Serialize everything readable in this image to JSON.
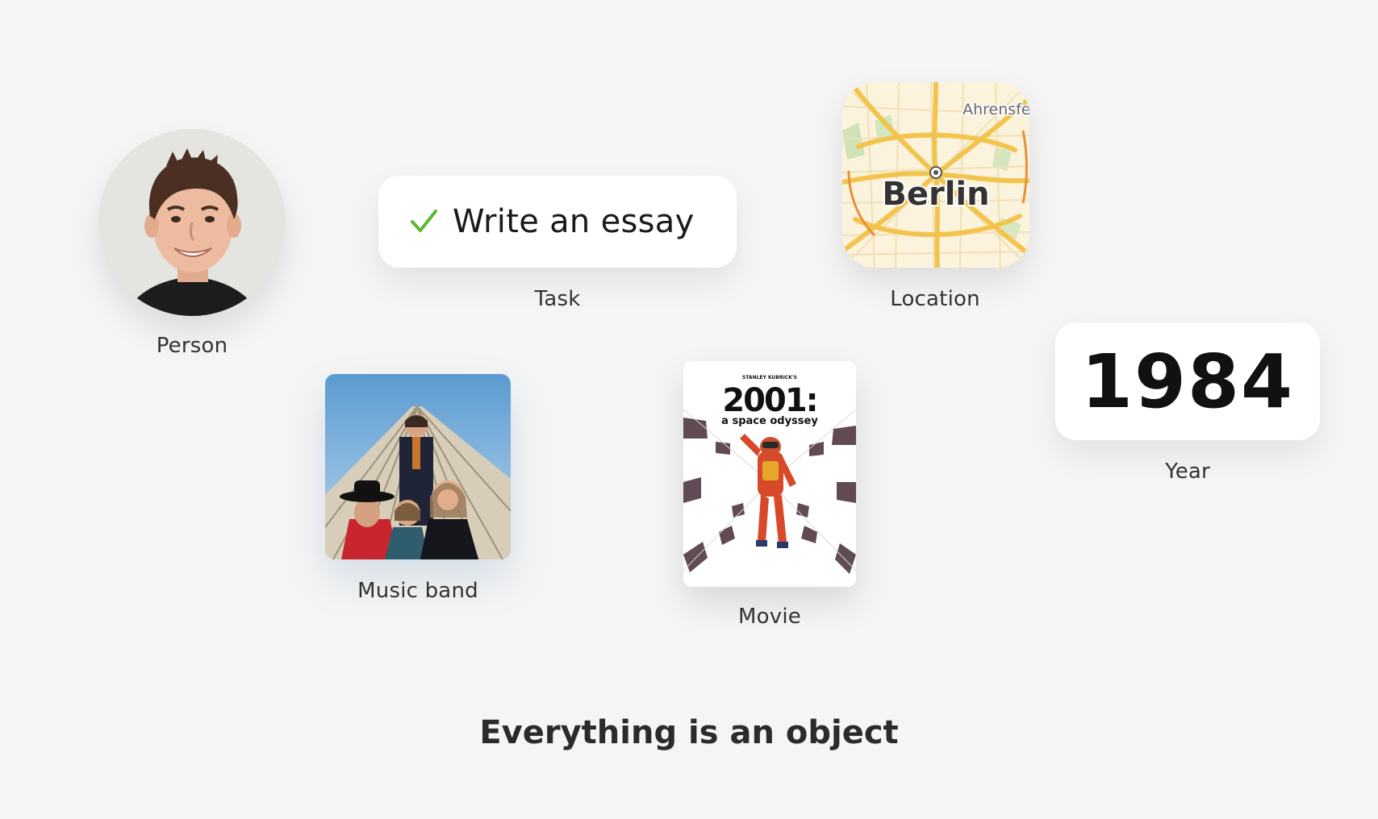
{
  "objects": {
    "person": {
      "label": "Person"
    },
    "task": {
      "label": "Task",
      "title": "Write an essay",
      "completed": true,
      "check_color": "#5cb82e"
    },
    "location": {
      "label": "Location",
      "city": "Berlin",
      "nearby": "Ahrensfel"
    },
    "year": {
      "label": "Year",
      "value": "1984"
    },
    "band": {
      "label": "Music band"
    },
    "movie": {
      "label": "Movie",
      "poster_credit": "STANLEY KUBRICK'S",
      "poster_title": "2001:",
      "poster_subtitle": "a space odyssey"
    }
  },
  "headline": "Everything is an object",
  "colors": {
    "background": "#f5f5f5",
    "card": "#ffffff",
    "text": "#2f2f2f"
  }
}
